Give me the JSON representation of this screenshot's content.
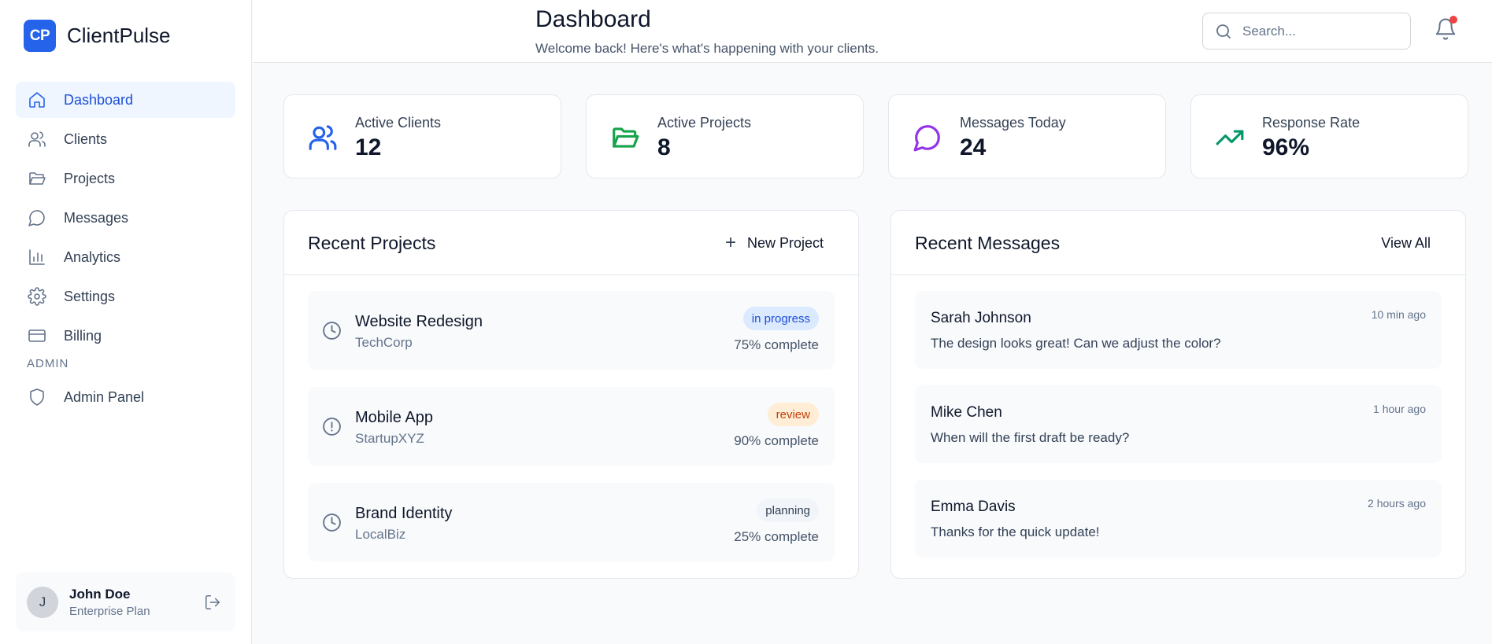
{
  "brand": {
    "logo": "CP",
    "name": "ClientPulse"
  },
  "sidebar": {
    "items": [
      {
        "label": "Dashboard",
        "icon": "home-icon",
        "active": true
      },
      {
        "label": "Clients",
        "icon": "users-icon"
      },
      {
        "label": "Projects",
        "icon": "folder-icon"
      },
      {
        "label": "Messages",
        "icon": "message-icon"
      },
      {
        "label": "Analytics",
        "icon": "bar-chart-icon"
      },
      {
        "label": "Settings",
        "icon": "gear-icon"
      },
      {
        "label": "Billing",
        "icon": "credit-card-icon"
      }
    ],
    "admin_section": "ADMIN",
    "admin_items": [
      {
        "label": "Admin Panel",
        "icon": "shield-icon"
      }
    ]
  },
  "user": {
    "initial": "J",
    "name": "John Doe",
    "plan": "Enterprise Plan"
  },
  "header": {
    "title": "Dashboard",
    "subtitle": "Welcome back! Here's what's happening with your clients.",
    "search_placeholder": "Search..."
  },
  "stats": [
    {
      "label": "Active Clients",
      "value": "12",
      "icon": "users-icon",
      "color": "#2563eb"
    },
    {
      "label": "Active Projects",
      "value": "8",
      "icon": "folder-icon",
      "color": "#16a34a"
    },
    {
      "label": "Messages Today",
      "value": "24",
      "icon": "message-icon",
      "color": "#9333ea"
    },
    {
      "label": "Response Rate",
      "value": "96%",
      "icon": "trending-up-icon",
      "color": "#059669"
    }
  ],
  "projects": {
    "title": "Recent Projects",
    "action": "New Project",
    "items": [
      {
        "name": "Website Redesign",
        "client": "TechCorp",
        "status": "in progress",
        "progress": "75% complete",
        "icon": "clock-icon"
      },
      {
        "name": "Mobile App",
        "client": "StartupXYZ",
        "status": "review",
        "progress": "90% complete",
        "icon": "alert-circle-icon"
      },
      {
        "name": "Brand Identity",
        "client": "LocalBiz",
        "status": "planning",
        "progress": "25% complete",
        "icon": "clock-icon"
      }
    ]
  },
  "messages": {
    "title": "Recent Messages",
    "action": "View All",
    "items": [
      {
        "sender": "Sarah Johnson",
        "text": "The design looks great! Can we adjust the color?",
        "time": "10 min ago"
      },
      {
        "sender": "Mike Chen",
        "text": "When will the first draft be ready?",
        "time": "1 hour ago"
      },
      {
        "sender": "Emma Davis",
        "text": "Thanks for the quick update!",
        "time": "2 hours ago"
      }
    ]
  }
}
